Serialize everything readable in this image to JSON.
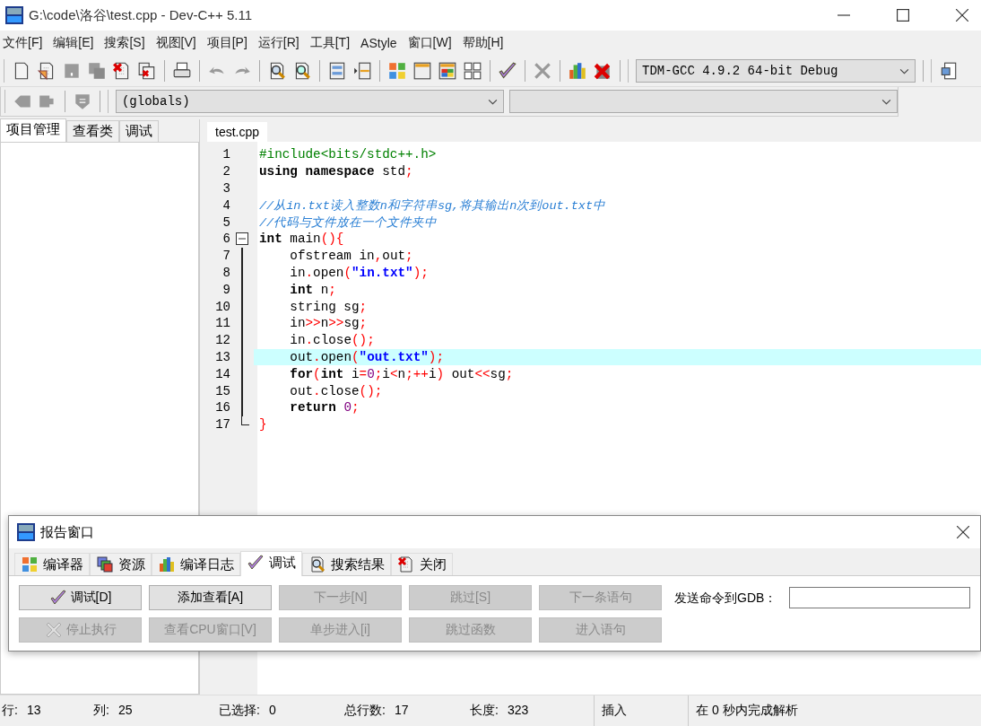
{
  "window": {
    "title": "G:\\code\\洛谷\\test.cpp - Dev-C++ 5.11"
  },
  "menu": [
    "文件[F]",
    "编辑[E]",
    "搜索[S]",
    "视图[V]",
    "项目[P]",
    "运行[R]",
    "工具[T]",
    "AStyle",
    "窗口[W]",
    "帮助[H]"
  ],
  "toolbar": {
    "compiler_select": "TDM-GCC 4.9.2 64-bit Debug",
    "scope_select": "(globals)"
  },
  "left_tabs": [
    {
      "label": "项目管理",
      "selected": true
    },
    {
      "label": "查看类",
      "selected": false
    },
    {
      "label": "调试",
      "selected": false
    }
  ],
  "editor": {
    "tab": "test.cpp",
    "lines": [
      {
        "number": "1",
        "kind": "plain",
        "highlighted": false,
        "tokens": [
          {
            "kind": "pp",
            "text": "#include<bits/stdc++.h>"
          }
        ]
      },
      {
        "number": "2",
        "kind": "plain",
        "highlighted": false,
        "tokens": [
          {
            "kind": "kw",
            "text": "using"
          },
          {
            "kind": "kw",
            "text": " namespace"
          },
          {
            "kind": "id",
            "text": " std"
          },
          {
            "kind": "op",
            "text": ";"
          }
        ]
      },
      {
        "number": "3",
        "kind": "plain",
        "highlighted": false
      },
      {
        "number": "4",
        "kind": "plain",
        "highlighted": false,
        "tokens": [
          {
            "kind": "cmt",
            "text": "//从in.txt读入整数n和字符串sg,将其输出n次到out.txt中"
          }
        ]
      },
      {
        "number": "5",
        "kind": "plain",
        "highlighted": false,
        "tokens": [
          {
            "kind": "cmt",
            "text": "//代码与文件放在一个文件夹中"
          }
        ]
      },
      {
        "number": "6",
        "kind": "fold_start",
        "highlighted": false,
        "tokens": [
          {
            "kind": "kw",
            "text": "int"
          },
          {
            "kind": "id",
            "text": " main"
          },
          {
            "kind": "op",
            "text": "(){"
          }
        ]
      },
      {
        "number": "7",
        "kind": "fold_body",
        "highlighted": false,
        "tokens": [
          {
            "kind": "id",
            "text": "    ofstream in"
          },
          {
            "kind": "op",
            "text": ","
          },
          {
            "kind": "id",
            "text": "out"
          },
          {
            "kind": "op",
            "text": ";"
          }
        ]
      },
      {
        "number": "8",
        "kind": "fold_body",
        "highlighted": false,
        "tokens": [
          {
            "kind": "id",
            "text": "    in"
          },
          {
            "kind": "op",
            "text": "."
          },
          {
            "kind": "id",
            "text": "open"
          },
          {
            "kind": "op",
            "text": "("
          },
          {
            "kind": "str",
            "text": "\"in.txt\""
          },
          {
            "kind": "op",
            "text": ");"
          }
        ]
      },
      {
        "number": "9",
        "kind": "fold_body",
        "highlighted": false,
        "tokens": [
          {
            "kind": "kw",
            "text": "    int"
          },
          {
            "kind": "id",
            "text": " n"
          },
          {
            "kind": "op",
            "text": ";"
          }
        ]
      },
      {
        "number": "10",
        "kind": "fold_body",
        "highlighted": false,
        "tokens": [
          {
            "kind": "id",
            "text": "    string sg"
          },
          {
            "kind": "op",
            "text": ";"
          }
        ]
      },
      {
        "number": "11",
        "kind": "fold_body",
        "highlighted": false,
        "tokens": [
          {
            "kind": "id",
            "text": "    in"
          },
          {
            "kind": "op",
            "text": ">>"
          },
          {
            "kind": "id",
            "text": "n"
          },
          {
            "kind": "op",
            "text": ">>"
          },
          {
            "kind": "id",
            "text": "sg"
          },
          {
            "kind": "op",
            "text": ";"
          }
        ]
      },
      {
        "number": "12",
        "kind": "fold_body",
        "highlighted": false,
        "tokens": [
          {
            "kind": "id",
            "text": "    in"
          },
          {
            "kind": "op",
            "text": "."
          },
          {
            "kind": "id",
            "text": "close"
          },
          {
            "kind": "op",
            "text": "();"
          }
        ]
      },
      {
        "number": "13",
        "kind": "fold_body",
        "highlighted": true,
        "tokens": [
          {
            "kind": "id",
            "text": "    out"
          },
          {
            "kind": "op",
            "text": "."
          },
          {
            "kind": "id",
            "text": "open"
          },
          {
            "kind": "op",
            "text": "("
          },
          {
            "kind": "str",
            "text": "\"out.txt\""
          },
          {
            "kind": "op",
            "text": ");"
          }
        ]
      },
      {
        "number": "14",
        "kind": "fold_body",
        "highlighted": false,
        "tokens": [
          {
            "kind": "kw",
            "text": "    for"
          },
          {
            "kind": "op",
            "text": "("
          },
          {
            "kind": "kw",
            "text": "int"
          },
          {
            "kind": "id",
            "text": " i"
          },
          {
            "kind": "op",
            "text": "="
          },
          {
            "kind": "num",
            "text": "0"
          },
          {
            "kind": "op",
            "text": ";"
          },
          {
            "kind": "id",
            "text": "i"
          },
          {
            "kind": "op",
            "text": "<"
          },
          {
            "kind": "id",
            "text": "n"
          },
          {
            "kind": "op",
            "text": ";++"
          },
          {
            "kind": "id",
            "text": "i"
          },
          {
            "kind": "op",
            "text": ")"
          },
          {
            "kind": "id",
            "text": " out"
          },
          {
            "kind": "op",
            "text": "<<"
          },
          {
            "kind": "id",
            "text": "sg"
          },
          {
            "kind": "op",
            "text": ";"
          }
        ]
      },
      {
        "number": "15",
        "kind": "fold_body",
        "highlighted": false,
        "tokens": [
          {
            "kind": "id",
            "text": "    out"
          },
          {
            "kind": "op",
            "text": "."
          },
          {
            "kind": "id",
            "text": "close"
          },
          {
            "kind": "op",
            "text": "();"
          }
        ]
      },
      {
        "number": "16",
        "kind": "fold_body",
        "highlighted": false,
        "tokens": [
          {
            "kind": "kw",
            "text": "    return"
          },
          {
            "kind": "num",
            "text": " 0"
          },
          {
            "kind": "op",
            "text": ";"
          }
        ]
      },
      {
        "number": "17",
        "kind": "fold_end",
        "highlighted": false,
        "tokens": [
          {
            "kind": "op",
            "text": "}"
          }
        ]
      }
    ]
  },
  "report": {
    "title": "报告窗口",
    "tabs": [
      {
        "label": "编译器",
        "selected": false
      },
      {
        "label": "资源",
        "selected": false
      },
      {
        "label": "编译日志",
        "selected": false
      },
      {
        "label": "调试",
        "selected": true
      },
      {
        "label": "搜索结果",
        "selected": false
      },
      {
        "label": "关闭",
        "selected": false
      }
    ],
    "buttons": [
      {
        "label": "调试[D]",
        "disabled": false,
        "kind": "check"
      },
      {
        "label": "添加查看[A]",
        "disabled": false,
        "kind": "plain"
      },
      {
        "label": "下一步[N]",
        "disabled": true,
        "kind": "plain"
      },
      {
        "label": "跳过[S]",
        "disabled": true,
        "kind": "plain"
      },
      {
        "label": "下一条语句",
        "disabled": true,
        "kind": "plain"
      },
      {
        "label": "停止执行",
        "disabled": true,
        "kind": "stop"
      },
      {
        "label": "查看CPU窗口[V]",
        "disabled": true,
        "kind": "plain"
      },
      {
        "label": "单步进入[i]",
        "disabled": true,
        "kind": "plain"
      },
      {
        "label": "跳过函数",
        "disabled": true,
        "kind": "plain"
      },
      {
        "label": "进入语句",
        "disabled": true,
        "kind": "plain"
      }
    ],
    "gdb_label": "发送命令到GDB："
  },
  "status_bar": {
    "fields": [
      {
        "label": "行:",
        "value": "13"
      },
      {
        "label": "列:",
        "value": "25"
      },
      {
        "label": "已选择:",
        "value": "0"
      },
      {
        "label": "总行数:",
        "value": "17"
      },
      {
        "label": "长度:",
        "value": "323"
      }
    ],
    "mode": "插入",
    "message": "在 0 秒内完成解析"
  }
}
